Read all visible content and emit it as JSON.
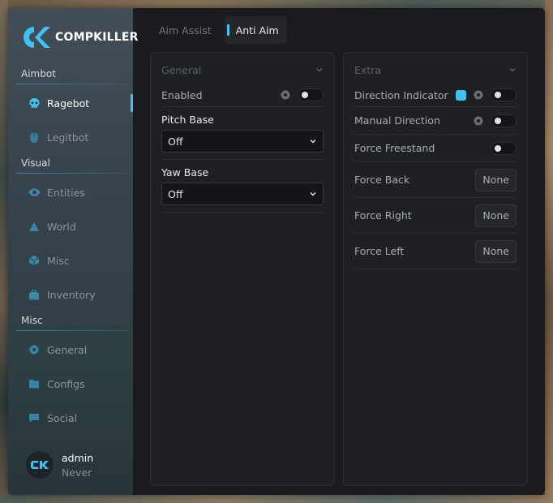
{
  "app": {
    "brand": "COMPKILLER",
    "accent_color": "#3ec3f2"
  },
  "sidebar": {
    "sections": [
      {
        "label": "Aimbot",
        "items": [
          {
            "label": "Ragebot",
            "icon": "skull-icon",
            "active": true
          },
          {
            "label": "Legitbot",
            "icon": "mouse-icon"
          }
        ]
      },
      {
        "label": "Visual",
        "items": [
          {
            "label": "Entities",
            "icon": "eye-icon"
          },
          {
            "label": "World",
            "icon": "triangle-icon"
          },
          {
            "label": "Misc",
            "icon": "cube-icon"
          },
          {
            "label": "Inventory",
            "icon": "briefcase-icon"
          }
        ]
      },
      {
        "label": "Misc",
        "items": [
          {
            "label": "General",
            "icon": "gear-icon"
          },
          {
            "label": "Configs",
            "icon": "folder-icon"
          },
          {
            "label": "Social",
            "icon": "chat-icon"
          }
        ]
      }
    ],
    "user": {
      "name": "admin",
      "subscription": "Never"
    }
  },
  "tabs": [
    {
      "label": "Aim Assist",
      "active": false
    },
    {
      "label": "Anti Aim",
      "active": true
    }
  ],
  "general_panel": {
    "title": "General",
    "enabled": {
      "label": "Enabled",
      "value": false
    },
    "pitch_base": {
      "label": "Pitch Base",
      "value": "Off"
    },
    "yaw_base": {
      "label": "Yaw Base",
      "value": "Off"
    }
  },
  "extra_panel": {
    "title": "Extra",
    "direction_indicator": {
      "label": "Direction Indicator",
      "value": false,
      "color": "#3ec3f2"
    },
    "manual_direction": {
      "label": "Manual Direction",
      "value": false
    },
    "force_freestand": {
      "label": "Force Freestand",
      "value": false
    },
    "force_back": {
      "label": "Force Back",
      "key": "None"
    },
    "force_right": {
      "label": "Force Right",
      "key": "None"
    },
    "force_left": {
      "label": "Force Left",
      "key": "None"
    }
  }
}
